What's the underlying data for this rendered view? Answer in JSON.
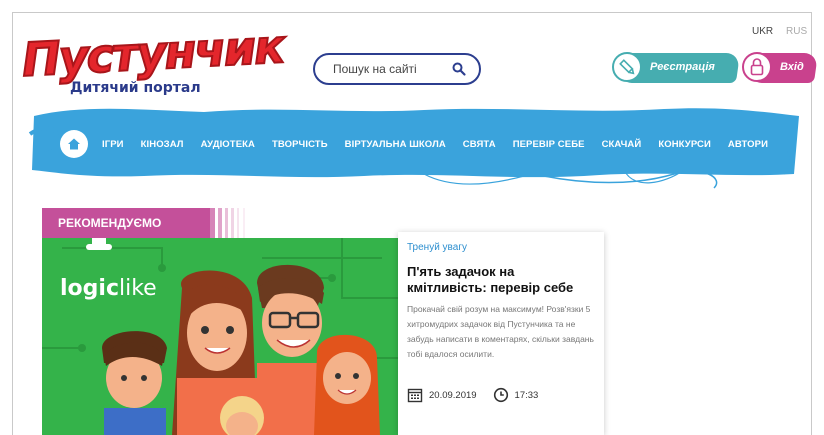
{
  "logo": {
    "text": "Пустунчик",
    "subtitle": "Дитячий портал"
  },
  "search": {
    "placeholder": "Пошук на сайті"
  },
  "lang": {
    "ukr": "UKR",
    "rus": "RUS"
  },
  "auth": {
    "register": "Реєстрація",
    "login": "Вхід"
  },
  "nav": {
    "items": [
      "ІГРИ",
      "КІНОЗАЛ",
      "АУДІОТЕКА",
      "ТВОРЧІСТЬ",
      "ВІРТУАЛЬНА ШКОЛА",
      "СВЯТА",
      "ПЕРЕВІР СЕБЕ",
      "СКАЧАЙ",
      "КОНКУРСИ",
      "АВТОРИ"
    ]
  },
  "recommended": {
    "label": "РЕКОМЕНДУЄМО",
    "hero_brand_bold": "logic",
    "hero_brand_light": "like"
  },
  "article": {
    "category": "Тренуй увагу",
    "title": "П'ять задачок на кмітливість: перевір себе",
    "text": "Прокачай свій розум на максимум! Розв'язки 5 хитромудрих задачок від Пустунчика та не забудь написати в коментарях, скільки завдань тобі вдалося осилити.",
    "date": "20.09.2019",
    "time": "17:33"
  },
  "colors": {
    "brand_red": "#e4262c",
    "nav_blue": "#3aa3dc",
    "teal": "#46adb0",
    "pink": "#c9418d",
    "green": "#34b34a"
  }
}
